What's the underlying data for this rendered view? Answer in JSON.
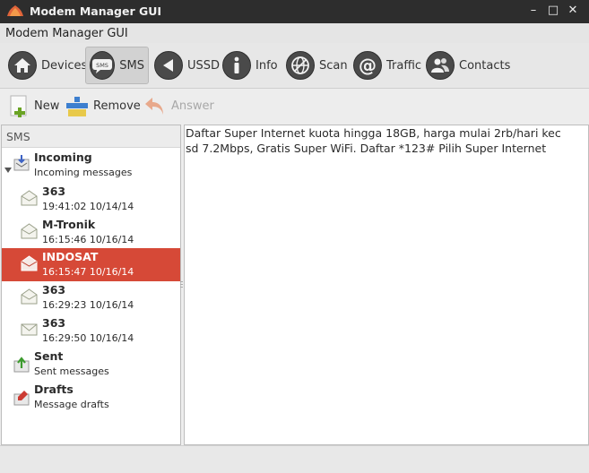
{
  "window": {
    "title": "Modem Manager GUI",
    "minimize": "–",
    "maximize": "□",
    "close": "✕"
  },
  "menubar": {
    "label": "Modem Manager GUI"
  },
  "toolbar": {
    "devices": "Devices",
    "sms": "SMS",
    "ussd": "USSD",
    "info": "Info",
    "scan": "Scan",
    "traffic": "Traffic",
    "contacts": "Contacts",
    "sms_icon_text": "SMS"
  },
  "sms_toolbar": {
    "new": "New",
    "remove": "Remove",
    "answer": "Answer"
  },
  "tree": {
    "header": "SMS",
    "folders": [
      {
        "title": "Incoming",
        "subtitle": "Incoming messages"
      },
      {
        "title": "Sent",
        "subtitle": "Sent messages"
      },
      {
        "title": "Drafts",
        "subtitle": "Message drafts"
      }
    ],
    "messages": [
      {
        "sender": "363",
        "time": "19:41:02 10/14/14"
      },
      {
        "sender": "M-Tronik",
        "time": "16:15:46 10/16/14"
      },
      {
        "sender": "INDOSAT",
        "time": "16:15:47 10/16/14"
      },
      {
        "sender": "363",
        "time": "16:29:23 10/16/14"
      },
      {
        "sender": "363",
        "time": "16:29:50 10/16/14"
      }
    ]
  },
  "message": {
    "body": "Daftar Super Internet kuota hingga 18GB, harga mulai 2rb/hari kec sd 7.2Mbps, Gratis Super WiFi. Daftar *123# Pilih Super Internet"
  },
  "colors": {
    "selection": "#d64937",
    "titlebar": "#2d2d2d"
  }
}
